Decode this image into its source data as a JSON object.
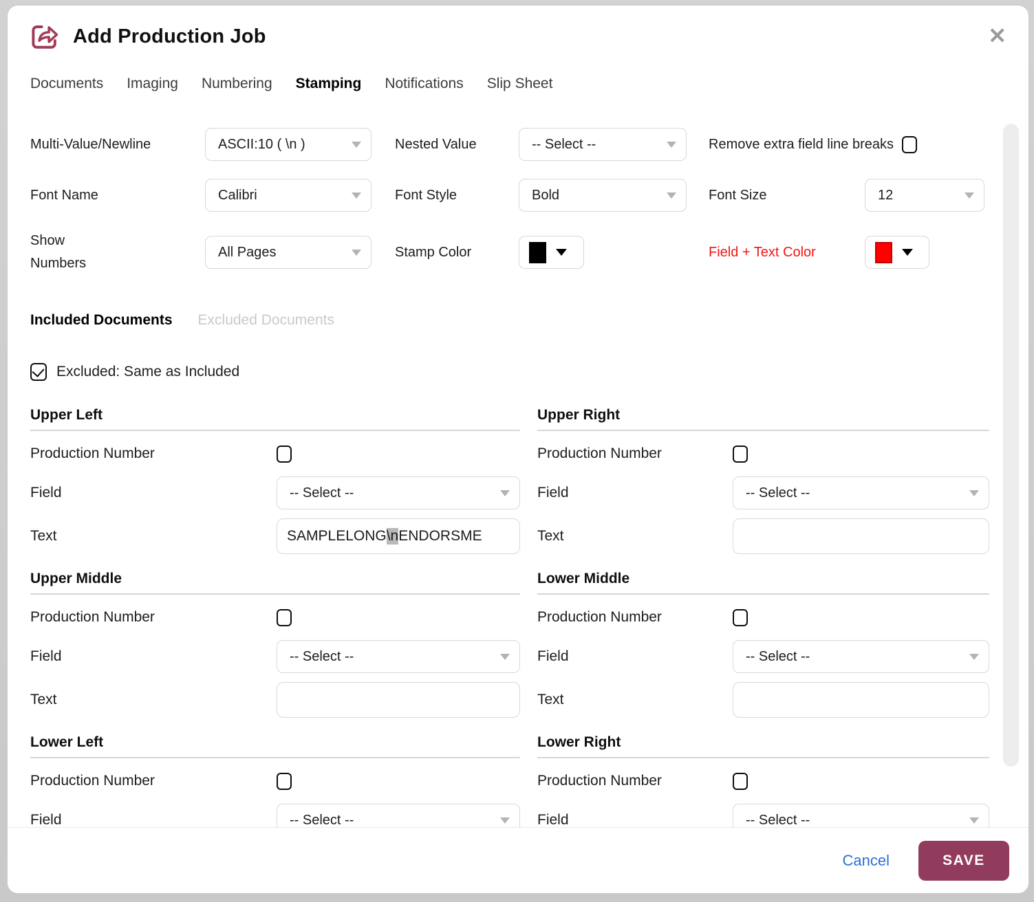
{
  "colors": {
    "accent": "#923C5D",
    "icon_maroon": "#A23B57",
    "cancel_blue": "#2D6FD2",
    "alert_red": "#F51313",
    "stamp_swatch": "#000000",
    "field_text_swatch": "#FF0000"
  },
  "header": {
    "title": "Add Production Job",
    "close_glyph": "✕"
  },
  "tabs": [
    {
      "label": "Documents",
      "active": false
    },
    {
      "label": "Imaging",
      "active": false
    },
    {
      "label": "Numbering",
      "active": false
    },
    {
      "label": "Stamping",
      "active": true
    },
    {
      "label": "Notifications",
      "active": false
    },
    {
      "label": "Slip Sheet",
      "active": false
    }
  ],
  "settings": {
    "multi_value": {
      "label": "Multi-Value/Newline",
      "value": "ASCII:10 ( \\n )"
    },
    "nested_value": {
      "label": "Nested Value",
      "value": "-- Select --"
    },
    "remove_breaks": {
      "label": "Remove extra field line breaks",
      "checked": false
    },
    "font_name": {
      "label": "Font Name",
      "value": "Calibri"
    },
    "font_style": {
      "label": "Font Style",
      "value": "Bold"
    },
    "font_size": {
      "label": "Font Size",
      "value": "12"
    },
    "show_numbers": {
      "label": "Show Numbers",
      "value": "All Pages"
    },
    "stamp_color": {
      "label": "Stamp Color",
      "swatch": "#000000"
    },
    "field_text_color": {
      "label": "Field + Text Color",
      "swatch": "#FF0000"
    }
  },
  "doc_tabs": {
    "included": {
      "label": "Included Documents",
      "active": true
    },
    "excluded": {
      "label": "Excluded Documents",
      "active": false
    }
  },
  "excluded_same": {
    "label": "Excluded: Same as Included",
    "checked": true
  },
  "labels": {
    "production_number": "Production Number",
    "field": "Field",
    "text": "Text"
  },
  "positions": [
    {
      "title": "Upper Left",
      "production_checked": false,
      "field_value": "-- Select --",
      "text": {
        "pre": "SAMPLELONG",
        "highlight": "\\n",
        "post": "ENDORSME"
      }
    },
    {
      "title": "Upper Right",
      "production_checked": false,
      "field_value": "-- Select --",
      "text": {
        "pre": "",
        "highlight": "",
        "post": ""
      }
    },
    {
      "title": "Upper Middle",
      "production_checked": false,
      "field_value": "-- Select --",
      "text": {
        "pre": "",
        "highlight": "",
        "post": ""
      }
    },
    {
      "title": "Lower Middle",
      "production_checked": false,
      "field_value": "-- Select --",
      "text": {
        "pre": "",
        "highlight": "",
        "post": ""
      }
    },
    {
      "title": "Lower Left",
      "production_checked": false,
      "field_value": "-- Select --"
    },
    {
      "title": "Lower Right",
      "production_checked": false,
      "field_value": "-- Select --"
    }
  ],
  "footer": {
    "cancel_label": "Cancel",
    "save_label": "SAVE"
  }
}
